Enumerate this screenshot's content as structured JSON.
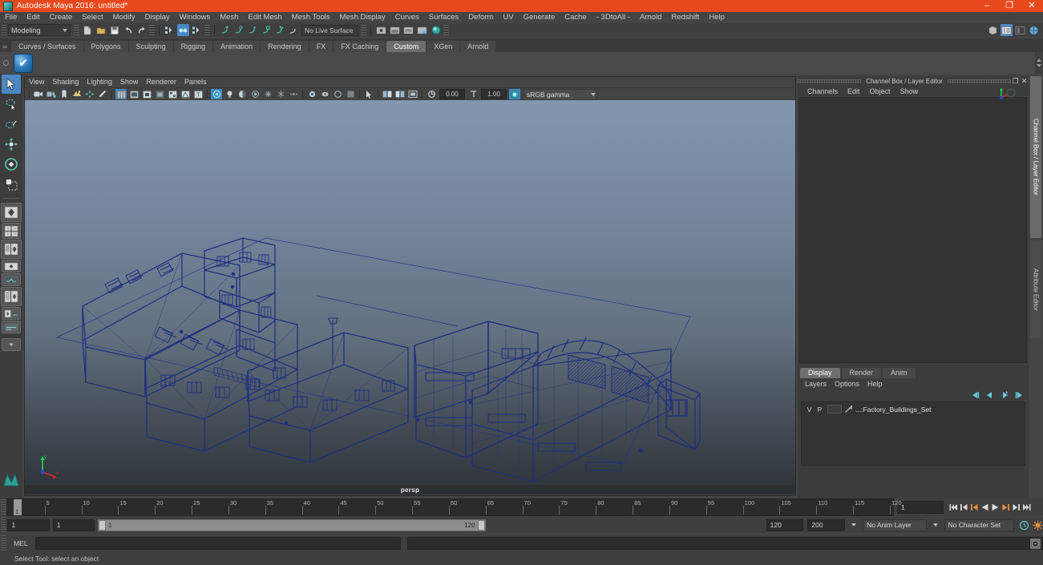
{
  "window": {
    "title": "Autodesk Maya 2016: untitled*",
    "app_icon": "maya-logo-icon",
    "minimize": "–",
    "maximize": "❐",
    "close": "✕",
    "accent_color": "#e8491c"
  },
  "menubar": {
    "items": [
      "File",
      "Edit",
      "Create",
      "Select",
      "Modify",
      "Display",
      "Windows",
      "Mesh",
      "Edit Mesh",
      "Mesh Tools",
      "Mesh Display",
      "Curves",
      "Surfaces",
      "Deform",
      "UV",
      "Generate",
      "Cache",
      "- 3DtoAll -",
      "Arnold",
      "Redshift",
      "Help"
    ]
  },
  "statusbar": {
    "menu_set": "Modeling",
    "live_surface": "No Live Surface",
    "icons": [
      "new-scene-icon",
      "open-scene-icon",
      "save-scene-icon",
      "undo-icon",
      "redo-icon",
      "select-by-hierarchy-icon",
      "select-by-object-icon",
      "select-by-component-icon",
      "snap-to-grid-icon",
      "snap-to-curve-icon",
      "snap-to-point-icon",
      "snap-to-projected-center-icon",
      "snap-to-view-plane-icon",
      "make-live-icon",
      "open-render-view-icon",
      "render-current-frame-icon",
      "ipr-render-icon",
      "render-settings-icon",
      "hypershade-icon"
    ],
    "right_icons": [
      "show-hide-modeling-toolkit-icon",
      "show-hide-attribute-editor-icon",
      "show-hide-tool-settings-icon",
      "show-hide-channel-box-icon"
    ]
  },
  "shelf": {
    "tabs": [
      "Curves / Surfaces",
      "Polygons",
      "Sculpting",
      "Rigging",
      "Animation",
      "Rendering",
      "FX",
      "FX Caching",
      "Custom",
      "XGen",
      "Arnold"
    ],
    "selected_tab": "Custom",
    "items": [
      {
        "name": "check-shield-icon",
        "glyph": "✔"
      }
    ]
  },
  "toolbox": {
    "tools": [
      {
        "name": "select-tool",
        "selected": true
      },
      {
        "name": "lasso-select-tool",
        "selected": false
      },
      {
        "name": "paint-select-tool",
        "selected": false
      },
      {
        "name": "move-tool",
        "selected": false
      },
      {
        "name": "rotate-tool",
        "selected": false
      },
      {
        "name": "scale-tool",
        "selected": false
      }
    ],
    "layout_buttons": [
      {
        "name": "single-perspective-view-layout"
      },
      {
        "name": "four-view-layout"
      },
      {
        "name": "persp-outliner-layout"
      },
      {
        "name": "persp-graph-editor-layout"
      },
      {
        "name": "hypershade-persp-layout"
      },
      {
        "name": "persp-uv-editor-layout"
      },
      {
        "name": "two-pane-stacked-layout"
      },
      {
        "name": "more-layouts-dropdown"
      }
    ]
  },
  "viewport": {
    "menus": [
      "View",
      "Shading",
      "Lighting",
      "Show",
      "Renderer",
      "Panels"
    ],
    "camera_label": "persp",
    "exposure_value": "0.00",
    "gamma_value": "1.00",
    "color_space": "sRGB gamma",
    "toolbar_icons": [
      "select-camera-icon",
      "camera-attributes-icon",
      "bookmark-icon",
      "image-plane-icon",
      "two-d-pan-zoom-icon",
      "grease-pencil-icon",
      "wireframe-shaded-icon",
      "smooth-shade-all-icon",
      "smooth-shade-selected-icon",
      "flat-shade-icon",
      "shaded-textured-icon",
      "wireframe-on-shaded-icon",
      "xray-icon",
      "use-default-lighting-icon",
      "use-all-lights-icon",
      "shadows-icon",
      "ambient-occlusion-icon",
      "motion-blur-icon",
      "anti-aliasing-icon",
      "multisample-icon",
      "isolate-select-icon",
      "xray-joints-icon",
      "xray-active-components-icon",
      "no-manipulators-icon",
      "exposure-icon",
      "gamma-icon",
      "color-management-icon"
    ],
    "background_top_color": "#8296ae",
    "background_bottom_color": "#2d3238",
    "wireframe_color": "#1f2f7a",
    "scene_description": "Factory buildings wireframe set viewed in perspective"
  },
  "channel_box": {
    "panel_title": "Channel Box / Layer Editor",
    "menus": [
      "Channels",
      "Edit",
      "Object",
      "Show"
    ],
    "maximize_glyph": "❐",
    "close_glyph": "✕"
  },
  "layer_editor": {
    "tabs": [
      "Display",
      "Render",
      "Anim"
    ],
    "selected_tab": "Display",
    "menus": [
      "Layers",
      "Options",
      "Help"
    ],
    "buttons": [
      "layer-first-icon",
      "layer-prev-icon",
      "layer-next-icon",
      "layer-last-icon"
    ],
    "columns": [
      "V",
      "P"
    ],
    "layers": [
      {
        "visible": "V",
        "playback": "P",
        "name": "...:Factory_Buildings_Set"
      }
    ]
  },
  "right_vtabs": {
    "tabs": [
      "Channel Box / Layer Editor",
      "Attribute Editor"
    ],
    "selected": "Channel Box / Layer Editor"
  },
  "timeline": {
    "start": 1,
    "end": 120,
    "tick_labels": [
      "5",
      "10",
      "15",
      "20",
      "25",
      "30",
      "35",
      "40",
      "45",
      "50",
      "55",
      "60",
      "65",
      "70",
      "75",
      "80",
      "85",
      "90",
      "95",
      "100",
      "105",
      "110",
      "115",
      "120"
    ],
    "current_frame": "1",
    "current_frame_field": "1",
    "playback_buttons": [
      "go-to-start-icon",
      "step-back-frame-icon",
      "step-back-key-icon",
      "play-backwards-icon",
      "play-forwards-icon",
      "step-forward-key-icon",
      "step-forward-frame-icon",
      "go-to-end-icon"
    ]
  },
  "range_slider": {
    "anim_start": "1",
    "range_start": "1",
    "range_bar_start": "1",
    "range_bar_end": "120",
    "range_end": "120",
    "anim_end": "200",
    "anim_layer": "No Anim Layer",
    "character_set": "No Character Set",
    "auto_key_icon": "auto-keyframe-icon",
    "anim_prefs_icon": "animation-preferences-icon"
  },
  "command_line": {
    "language": "MEL",
    "input_value": "",
    "output_value": "",
    "script_editor_icon": "script-editor-icon"
  },
  "help_line": {
    "text": "Select Tool: select an object"
  }
}
